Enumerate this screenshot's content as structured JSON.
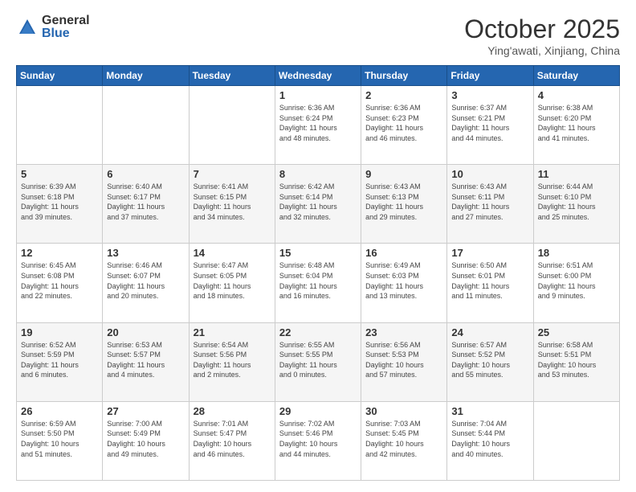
{
  "logo": {
    "general": "General",
    "blue": "Blue"
  },
  "header": {
    "month": "October 2025",
    "location": "Ying'awati, Xinjiang, China"
  },
  "weekdays": [
    "Sunday",
    "Monday",
    "Tuesday",
    "Wednesday",
    "Thursday",
    "Friday",
    "Saturday"
  ],
  "weeks": [
    [
      {
        "day": "",
        "info": ""
      },
      {
        "day": "",
        "info": ""
      },
      {
        "day": "",
        "info": ""
      },
      {
        "day": "1",
        "info": "Sunrise: 6:36 AM\nSunset: 6:24 PM\nDaylight: 11 hours\nand 48 minutes."
      },
      {
        "day": "2",
        "info": "Sunrise: 6:36 AM\nSunset: 6:23 PM\nDaylight: 11 hours\nand 46 minutes."
      },
      {
        "day": "3",
        "info": "Sunrise: 6:37 AM\nSunset: 6:21 PM\nDaylight: 11 hours\nand 44 minutes."
      },
      {
        "day": "4",
        "info": "Sunrise: 6:38 AM\nSunset: 6:20 PM\nDaylight: 11 hours\nand 41 minutes."
      }
    ],
    [
      {
        "day": "5",
        "info": "Sunrise: 6:39 AM\nSunset: 6:18 PM\nDaylight: 11 hours\nand 39 minutes."
      },
      {
        "day": "6",
        "info": "Sunrise: 6:40 AM\nSunset: 6:17 PM\nDaylight: 11 hours\nand 37 minutes."
      },
      {
        "day": "7",
        "info": "Sunrise: 6:41 AM\nSunset: 6:15 PM\nDaylight: 11 hours\nand 34 minutes."
      },
      {
        "day": "8",
        "info": "Sunrise: 6:42 AM\nSunset: 6:14 PM\nDaylight: 11 hours\nand 32 minutes."
      },
      {
        "day": "9",
        "info": "Sunrise: 6:43 AM\nSunset: 6:13 PM\nDaylight: 11 hours\nand 29 minutes."
      },
      {
        "day": "10",
        "info": "Sunrise: 6:43 AM\nSunset: 6:11 PM\nDaylight: 11 hours\nand 27 minutes."
      },
      {
        "day": "11",
        "info": "Sunrise: 6:44 AM\nSunset: 6:10 PM\nDaylight: 11 hours\nand 25 minutes."
      }
    ],
    [
      {
        "day": "12",
        "info": "Sunrise: 6:45 AM\nSunset: 6:08 PM\nDaylight: 11 hours\nand 22 minutes."
      },
      {
        "day": "13",
        "info": "Sunrise: 6:46 AM\nSunset: 6:07 PM\nDaylight: 11 hours\nand 20 minutes."
      },
      {
        "day": "14",
        "info": "Sunrise: 6:47 AM\nSunset: 6:05 PM\nDaylight: 11 hours\nand 18 minutes."
      },
      {
        "day": "15",
        "info": "Sunrise: 6:48 AM\nSunset: 6:04 PM\nDaylight: 11 hours\nand 16 minutes."
      },
      {
        "day": "16",
        "info": "Sunrise: 6:49 AM\nSunset: 6:03 PM\nDaylight: 11 hours\nand 13 minutes."
      },
      {
        "day": "17",
        "info": "Sunrise: 6:50 AM\nSunset: 6:01 PM\nDaylight: 11 hours\nand 11 minutes."
      },
      {
        "day": "18",
        "info": "Sunrise: 6:51 AM\nSunset: 6:00 PM\nDaylight: 11 hours\nand 9 minutes."
      }
    ],
    [
      {
        "day": "19",
        "info": "Sunrise: 6:52 AM\nSunset: 5:59 PM\nDaylight: 11 hours\nand 6 minutes."
      },
      {
        "day": "20",
        "info": "Sunrise: 6:53 AM\nSunset: 5:57 PM\nDaylight: 11 hours\nand 4 minutes."
      },
      {
        "day": "21",
        "info": "Sunrise: 6:54 AM\nSunset: 5:56 PM\nDaylight: 11 hours\nand 2 minutes."
      },
      {
        "day": "22",
        "info": "Sunrise: 6:55 AM\nSunset: 5:55 PM\nDaylight: 11 hours\nand 0 minutes."
      },
      {
        "day": "23",
        "info": "Sunrise: 6:56 AM\nSunset: 5:53 PM\nDaylight: 10 hours\nand 57 minutes."
      },
      {
        "day": "24",
        "info": "Sunrise: 6:57 AM\nSunset: 5:52 PM\nDaylight: 10 hours\nand 55 minutes."
      },
      {
        "day": "25",
        "info": "Sunrise: 6:58 AM\nSunset: 5:51 PM\nDaylight: 10 hours\nand 53 minutes."
      }
    ],
    [
      {
        "day": "26",
        "info": "Sunrise: 6:59 AM\nSunset: 5:50 PM\nDaylight: 10 hours\nand 51 minutes."
      },
      {
        "day": "27",
        "info": "Sunrise: 7:00 AM\nSunset: 5:49 PM\nDaylight: 10 hours\nand 49 minutes."
      },
      {
        "day": "28",
        "info": "Sunrise: 7:01 AM\nSunset: 5:47 PM\nDaylight: 10 hours\nand 46 minutes."
      },
      {
        "day": "29",
        "info": "Sunrise: 7:02 AM\nSunset: 5:46 PM\nDaylight: 10 hours\nand 44 minutes."
      },
      {
        "day": "30",
        "info": "Sunrise: 7:03 AM\nSunset: 5:45 PM\nDaylight: 10 hours\nand 42 minutes."
      },
      {
        "day": "31",
        "info": "Sunrise: 7:04 AM\nSunset: 5:44 PM\nDaylight: 10 hours\nand 40 minutes."
      },
      {
        "day": "",
        "info": ""
      }
    ]
  ]
}
